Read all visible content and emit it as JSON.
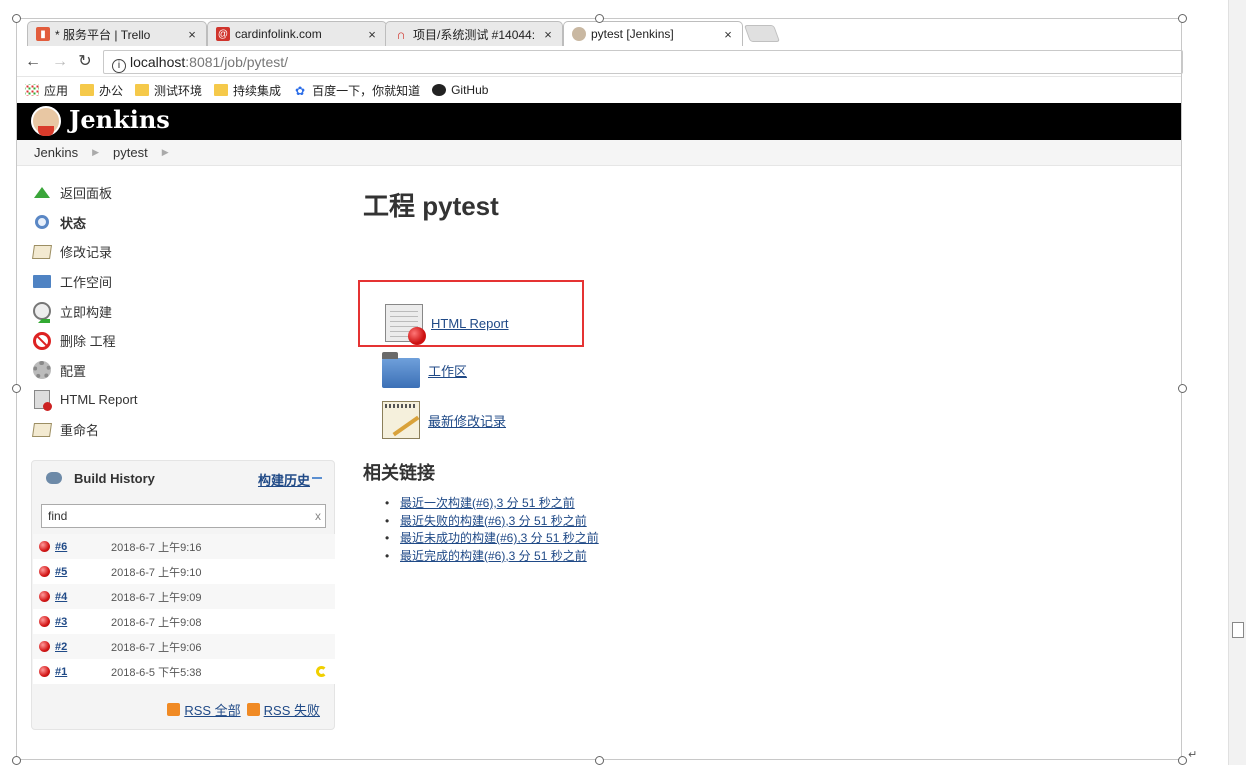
{
  "browser": {
    "tabs": [
      {
        "title": "* 服务平台 | Trello",
        "icon": "trello-icon",
        "color": "#e25c3c",
        "active": false
      },
      {
        "title": "cardinfolink.com",
        "icon": "mail-at-icon",
        "color": "#d0342c",
        "active": false
      },
      {
        "title": "项目/系统测试 #14044:",
        "icon": "rainbow-icon",
        "color": "#d0342c",
        "active": false
      },
      {
        "title": "pytest [Jenkins]",
        "icon": "jenkins-favicon",
        "color": "#888888",
        "active": true
      }
    ],
    "close_glyph": "×",
    "url_host": "localhost",
    "url_rest": ":8081/job/pytest/",
    "bookmarks": [
      {
        "label": "应用",
        "icon": "apps-icon"
      },
      {
        "label": "办公",
        "icon": "folder-icon"
      },
      {
        "label": "测试环境",
        "icon": "folder-icon"
      },
      {
        "label": "持续集成",
        "icon": "folder-icon"
      },
      {
        "label": "百度一下，你就知道",
        "icon": "baidu-paw-icon"
      },
      {
        "label": "GitHub",
        "icon": "github-icon"
      }
    ]
  },
  "jenkins": {
    "logo_text": "Jenkins",
    "breadcrumb": [
      "Jenkins",
      "pytest"
    ],
    "tasks": [
      {
        "label": "返回面板",
        "icon": "up-arrow-icon",
        "bold": false
      },
      {
        "label": "状态",
        "icon": "search-icon",
        "bold": true
      },
      {
        "label": "修改记录",
        "icon": "notepad-icon",
        "bold": false
      },
      {
        "label": "工作空间",
        "icon": "folder-icon",
        "bold": false
      },
      {
        "label": "立即构建",
        "icon": "build-clock-icon",
        "bold": false
      },
      {
        "label": "删除 工程",
        "icon": "no-entry-icon",
        "bold": false
      },
      {
        "label": "配置",
        "icon": "gear-icon",
        "bold": false
      },
      {
        "label": "HTML Report",
        "icon": "report-icon",
        "bold": false
      },
      {
        "label": "重命名",
        "icon": "notepad-pencil-icon",
        "bold": false
      }
    ],
    "build_history": {
      "title": "Build History",
      "trend_label": "构建历史",
      "search_value": "find",
      "search_clear": "x",
      "builds": [
        {
          "number": "#6",
          "date": "2018-6-7 上午9:16",
          "status": "failed"
        },
        {
          "number": "#5",
          "date": "2018-6-7 上午9:10",
          "status": "failed"
        },
        {
          "number": "#4",
          "date": "2018-6-7 上午9:09",
          "status": "failed"
        },
        {
          "number": "#3",
          "date": "2018-6-7 上午9:08",
          "status": "failed"
        },
        {
          "number": "#2",
          "date": "2018-6-7 上午9:06",
          "status": "failed"
        },
        {
          "number": "#1",
          "date": "2018-6-5 下午5:38",
          "status": "failed"
        }
      ],
      "rss_all": "RSS 全部",
      "rss_failed": "RSS 失败"
    },
    "main": {
      "title": "工程 pytest",
      "links": [
        {
          "label": "HTML Report",
          "icon": "html-report-icon"
        },
        {
          "label": "工作区",
          "icon": "workspace-folder-icon"
        },
        {
          "label": "最新修改记录",
          "icon": "changes-notepad-icon"
        }
      ],
      "related_title": "相关链接",
      "related_links": [
        "最近一次构建(#6),3 分 51 秒之前",
        "最近失败的构建(#6),3 分 51 秒之前",
        "最近未成功的构建(#6),3 分 51 秒之前",
        "最近完成的构建(#6),3 分 51 秒之前"
      ]
    }
  }
}
